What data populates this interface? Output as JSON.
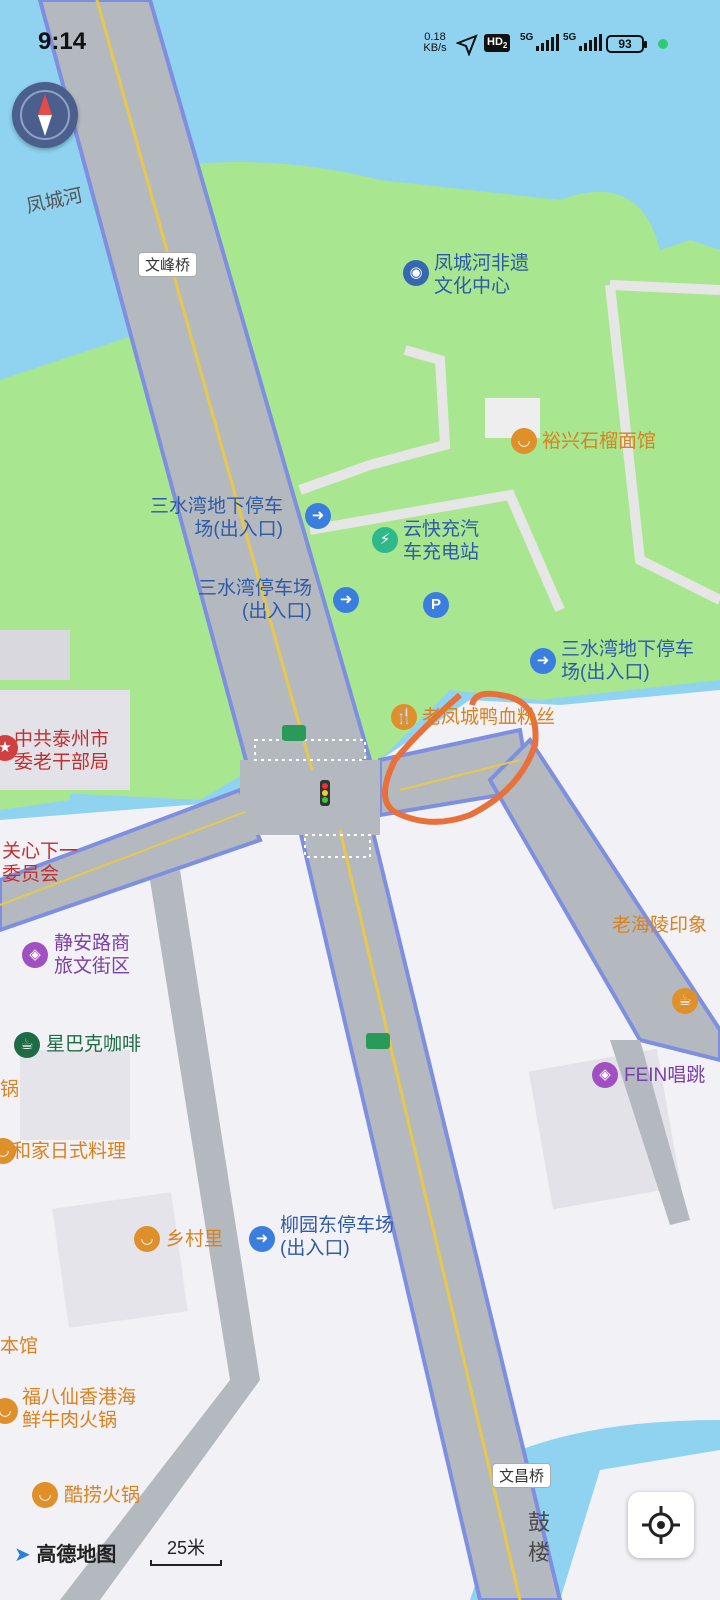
{
  "status_bar": {
    "time": "9:14",
    "net_speed_value": "0.18",
    "net_speed_unit": "KB/s",
    "hd_label": "HD",
    "hd_sub": "2",
    "signal1_label": "5G",
    "signal2_label": "5G",
    "battery": "93"
  },
  "map": {
    "water_labels": [
      "凤城河"
    ],
    "bridges": [
      "文峰桥",
      "文昌桥"
    ],
    "roads": [
      "鼓楼"
    ],
    "pois": [
      {
        "icon": "museum-icon",
        "lines": [
          "凤城河非遗",
          "文化中心"
        ],
        "color": "#3568b0"
      },
      {
        "icon": "restaurant-icon",
        "lines": [
          "裕兴石榴面馆"
        ],
        "color": "#e0902a"
      },
      {
        "icon": "parking-entrance-icon",
        "lines": [
          "三水湾地下停车",
          "场(出入口)"
        ],
        "color": "#3a7fe0"
      },
      {
        "icon": "ev-charging-icon",
        "lines": [
          "云快充汽",
          "车充电站"
        ],
        "color": "#2fb98a"
      },
      {
        "icon": "parking-entrance-icon",
        "lines": [
          "三水湾停车场",
          "(出入口)"
        ],
        "color": "#3a7fe0"
      },
      {
        "icon": "parking-icon",
        "lines": [],
        "label": "P",
        "color": "#3a7fe0"
      },
      {
        "icon": "parking-entrance-icon",
        "lines": [
          "三水湾地下停车",
          "场(出入口)"
        ],
        "color": "#3a7fe0"
      },
      {
        "icon": "restaurant-icon",
        "lines": [
          "老凤城鸭血粉丝"
        ],
        "color": "#e0902a"
      },
      {
        "icon": "government-icon",
        "lines": [
          "中共泰州市",
          "委老干部局"
        ],
        "color": "#d04040"
      },
      {
        "icon": "",
        "lines": [
          "关心下一",
          "委员会"
        ],
        "color": ""
      },
      {
        "icon": "shopping-icon",
        "lines": [
          "静安路商",
          "旅文街区"
        ],
        "color": "#a050c0"
      },
      {
        "icon": "starbucks-icon",
        "lines": [
          "星巴克咖啡"
        ],
        "color": "#1e6b45"
      },
      {
        "icon": "",
        "lines": [
          "锅"
        ],
        "color": ""
      },
      {
        "icon": "restaurant-icon",
        "lines": [
          "和家日式料理"
        ],
        "color": "#e0902a"
      },
      {
        "icon": "restaurant-icon",
        "lines": [
          "乡村里"
        ],
        "color": "#e0902a"
      },
      {
        "icon": "parking-entrance-icon",
        "lines": [
          "柳园东停车场",
          "(出入口)"
        ],
        "color": "#3a7fe0"
      },
      {
        "icon": "",
        "lines": [
          "本馆"
        ],
        "color": ""
      },
      {
        "icon": "restaurant-icon",
        "lines": [
          "福八仙香港海",
          "鲜牛肉火锅"
        ],
        "color": "#e0902a"
      },
      {
        "icon": "restaurant-icon",
        "lines": [
          "酷捞火锅"
        ],
        "color": "#e0902a"
      },
      {
        "icon": "",
        "lines": [
          "老海陵印象"
        ],
        "color": ""
      },
      {
        "icon": "cafe-icon",
        "lines": [
          ""
        ],
        "color": "#e0902a"
      },
      {
        "icon": "ktv-icon",
        "lines": [
          "FEIN唱跳"
        ],
        "color": "#a050c0"
      }
    ]
  },
  "footer": {
    "logo_text": "高德地图",
    "scale_label": "25米"
  },
  "colors": {
    "water": "#8fd3f0",
    "park": "#a8e690",
    "land": "#f2f1f6",
    "road": "#b4b9c0",
    "road_edge": "#7f8fe0",
    "center_line": "#e8c84a",
    "annotation": "#e8703a"
  }
}
